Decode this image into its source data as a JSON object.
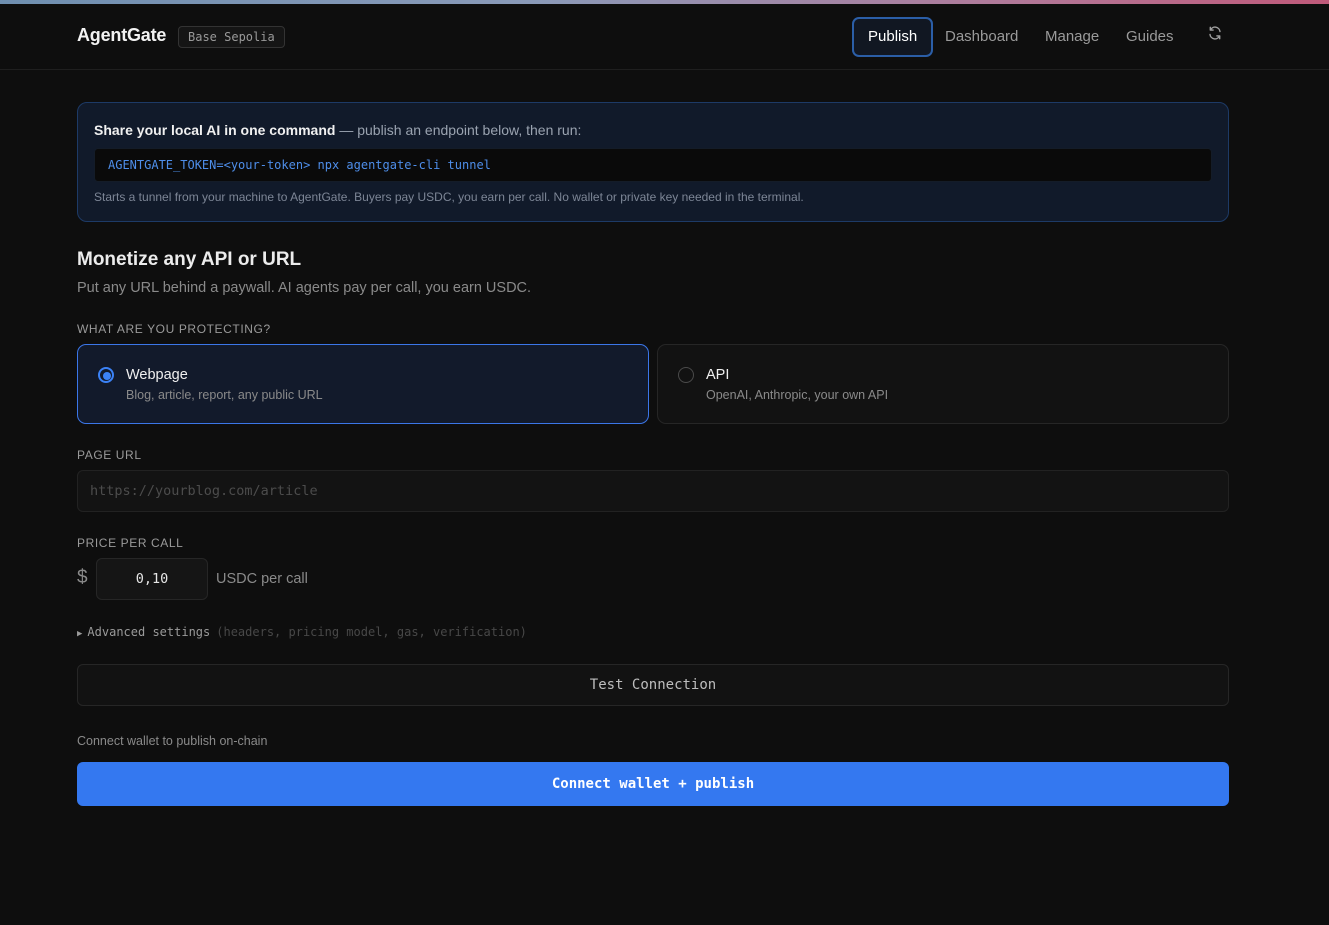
{
  "brand": {
    "name": "AgentGate",
    "network": "Base Sepolia"
  },
  "nav": {
    "items": [
      {
        "label": "Publish",
        "active": true
      },
      {
        "label": "Dashboard",
        "active": false
      },
      {
        "label": "Manage",
        "active": false
      },
      {
        "label": "Guides",
        "active": false
      }
    ],
    "refresh_icon": "refresh-icon"
  },
  "cli_card": {
    "title": "Share your local AI in one command",
    "subtitle": "— publish an endpoint below, then run:",
    "command": "AGENTGATE_TOKEN=<your-token> npx agentgate-cli tunnel",
    "note": "Starts a tunnel from your machine to AgentGate. Buyers pay USDC, you earn per call. No wallet or private key needed in the terminal."
  },
  "main": {
    "title": "Monetize any API or URL",
    "subtitle": "Put any URL behind a paywall. AI agents pay per call, you earn USDC."
  },
  "protect": {
    "label": "WHAT ARE YOU PROTECTING?",
    "options": [
      {
        "title": "Webpage",
        "desc": "Blog, article, report, any public URL",
        "selected": true
      },
      {
        "title": "API",
        "desc": "OpenAI, Anthropic, your own API",
        "selected": false
      }
    ]
  },
  "page_url": {
    "label": "PAGE URL",
    "value": "",
    "placeholder": "https://yourblog.com/article"
  },
  "price": {
    "label": "PRICE PER CALL",
    "currency": "$",
    "value": "0,10",
    "unit": "USDC per call"
  },
  "advanced": {
    "label": "Advanced settings",
    "hint": "(headers, pricing model, gas, verification)"
  },
  "actions": {
    "test_label": "Test Connection",
    "connect_note": "Connect wallet to publish on-chain",
    "publish_label": "Connect wallet + publish"
  },
  "colors": {
    "accent": "#3478f0",
    "background": "#0e0e0e",
    "card_bg": "#111a2a",
    "code_text": "#4e8eea"
  }
}
